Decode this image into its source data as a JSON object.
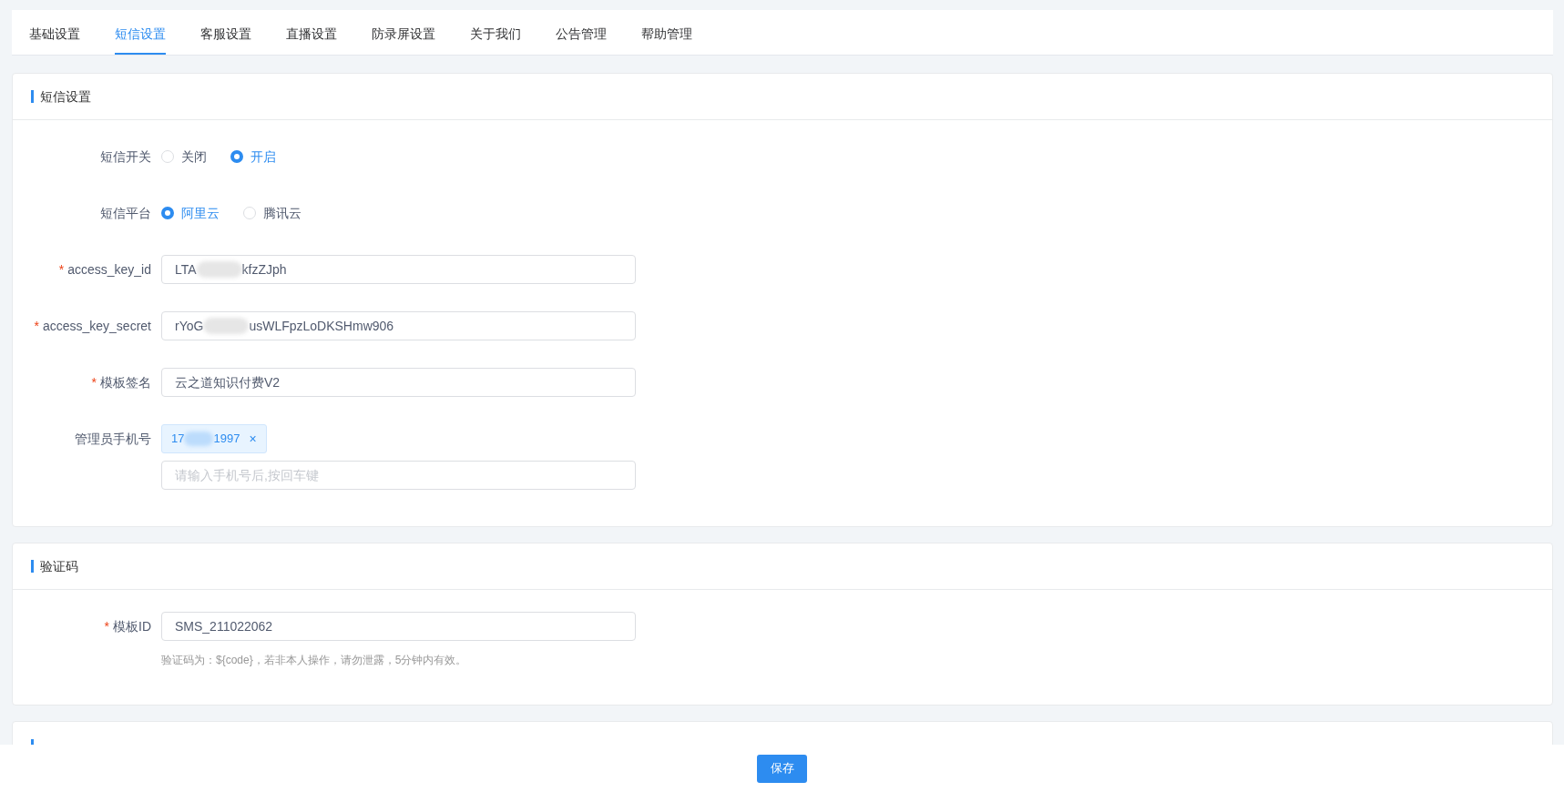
{
  "tabs": [
    {
      "label": "基础设置",
      "selected": false
    },
    {
      "label": "短信设置",
      "selected": true
    },
    {
      "label": "客服设置",
      "selected": false
    },
    {
      "label": "直播设置",
      "selected": false
    },
    {
      "label": "防录屏设置",
      "selected": false
    },
    {
      "label": "关于我们",
      "selected": false
    },
    {
      "label": "公告管理",
      "selected": false
    },
    {
      "label": "帮助管理",
      "selected": false
    }
  ],
  "sections": [
    {
      "title": "短信设置",
      "fields": [
        {
          "kind": "radio",
          "label": "短信开关",
          "options": [
            {
              "label": "关闭",
              "selected": false
            },
            {
              "label": "开启",
              "selected": true
            }
          ]
        },
        {
          "kind": "radio",
          "label": "短信平台",
          "options": [
            {
              "label": "阿里云",
              "selected": true
            },
            {
              "label": "腾讯云",
              "selected": false
            }
          ]
        },
        {
          "kind": "input",
          "label": "access_key_id",
          "required_mark": "*",
          "value_parts": [
            "LTA",
            "kfzZJph"
          ]
        },
        {
          "kind": "input",
          "label": "access_key_secret",
          "required_mark": "*",
          "value_parts": [
            "rYoG",
            "usWLFpzLoDKSHmw906"
          ]
        },
        {
          "kind": "input",
          "label": "模板签名",
          "required_mark": "*",
          "value_parts": [
            "云之道知识付费V2"
          ]
        },
        {
          "kind": "tags",
          "label": "管理员手机号",
          "tags": [
            {
              "value_parts": [
                "17",
                "1997"
              ],
              "remove": "×"
            }
          ],
          "placeholder": "请输入手机号后,按回车键"
        }
      ]
    },
    {
      "title": "验证码",
      "fields": [
        {
          "kind": "input",
          "label": "模板ID",
          "required_mark": "*",
          "value_parts": [
            "SMS_211022062"
          ],
          "hint": "验证码为：${code}，若非本人操作，请勿泄露，5分钟内有效。"
        }
      ]
    },
    {
      "kind": "cut_off"
    }
  ],
  "save_button": "保存"
}
